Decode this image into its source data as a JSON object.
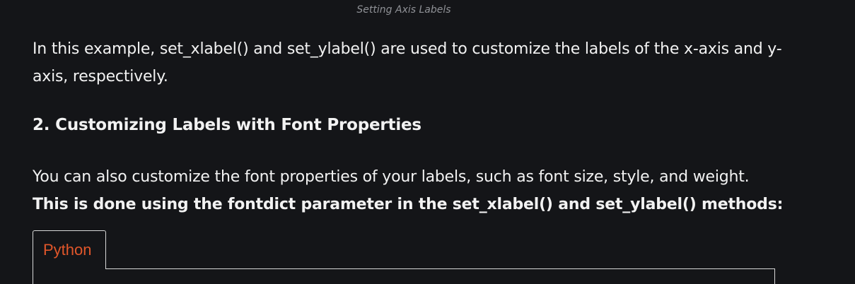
{
  "caption": "Setting Axis Labels",
  "intro_paragraph": "In this example, set_xlabel() and set_ylabel() are used to customize the labels of the x-axis and y-axis, respectively.",
  "section_heading": "2. Customizing Labels with Font Properties",
  "body_paragraph": "You can also customize the font properties of your labels, such as font size, style, and weight.",
  "body_paragraph_bold": "This is done using the fontdict parameter in the set_xlabel() and set_ylabel() methods:",
  "code_tab": {
    "label": "Python"
  },
  "colors": {
    "background": "#141518",
    "text": "#f2f2f2",
    "caption": "#8f9196",
    "tab_label": "#e1562a",
    "border": "#d8d8d8"
  }
}
